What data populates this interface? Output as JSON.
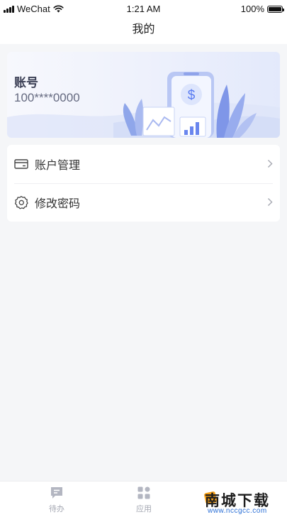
{
  "status_bar": {
    "carrier": "WeChat",
    "time": "1:21 AM",
    "battery": "100%"
  },
  "header": {
    "title": "我的"
  },
  "account_card": {
    "label": "账号",
    "number": "100****0000"
  },
  "menu": {
    "items": [
      {
        "label": "账户管理",
        "icon": "card-icon"
      },
      {
        "label": "修改密码",
        "icon": "gear-icon"
      }
    ]
  },
  "tab_bar": {
    "tabs": [
      {
        "label": "待办",
        "icon": "chat-icon"
      },
      {
        "label": "应用",
        "icon": "apps-icon"
      }
    ]
  },
  "watermark": {
    "main": "南城下载",
    "sub": "www.nccgcc.com",
    "colors": {
      "badge": "#f6a11a",
      "sub": "#2a6fd6"
    }
  },
  "colors": {
    "accent": "#5b7df2",
    "background": "#f5f6f8",
    "tab_inactive": "#a5a8b3"
  }
}
